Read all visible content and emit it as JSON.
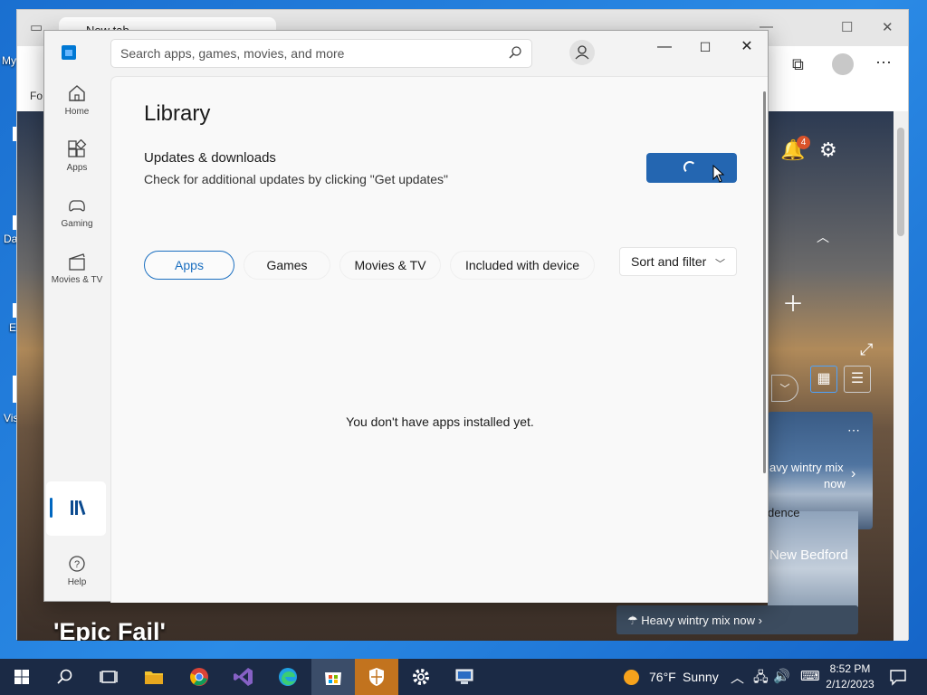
{
  "desktop": {
    "icon_labels": [
      "My",
      "Da",
      "E",
      "Vis"
    ]
  },
  "edge": {
    "tab_title": "New tab",
    "toolbar_left_text": "Fo",
    "epic_text": "'Epic Fail'",
    "notification_count": "4",
    "weather_card": {
      "headline_line1": "avy wintry mix",
      "headline_line2": "now",
      "map_label1": "dence",
      "map_label2": "New Bedford",
      "footer": "Heavy wintry mix now"
    }
  },
  "store": {
    "search_placeholder": "Search apps, games, movies, and more",
    "nav": [
      {
        "label": "Home",
        "icon": "home-icon"
      },
      {
        "label": "Apps",
        "icon": "apps-icon"
      },
      {
        "label": "Gaming",
        "icon": "gaming-icon"
      },
      {
        "label": "Movies & TV",
        "icon": "movies-icon"
      }
    ],
    "library_icon": "library-icon",
    "help_label": "Help",
    "page_title": "Library",
    "updates_title": "Updates & downloads",
    "updates_subtitle": "Check for additional updates by clicking \"Get updates\"",
    "filter_tabs": [
      "Apps",
      "Games",
      "Movies & TV",
      "Included with device"
    ],
    "active_tab": "Apps",
    "sort_label": "Sort and filter",
    "empty_message": "You don't have apps installed yet.",
    "accent_color": "#2466b1"
  },
  "taskbar": {
    "temperature": "76°F",
    "condition": "Sunny",
    "time": "8:52 PM",
    "date": "2/12/2023"
  }
}
